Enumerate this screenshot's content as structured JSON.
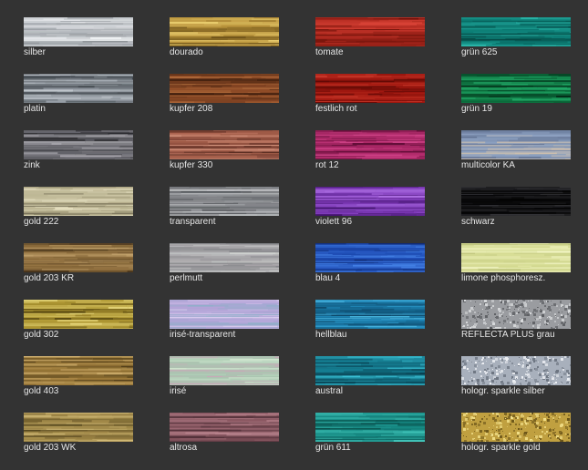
{
  "swatches": [
    {
      "label": "silber",
      "colors": [
        "#c4c8cc",
        "#f2f4f6",
        "#8c9196"
      ],
      "pattern": "stripe"
    },
    {
      "label": "platin",
      "colors": [
        "#868d94",
        "#c6ccd2",
        "#3c4248"
      ],
      "pattern": "stripe"
    },
    {
      "label": "zink",
      "colors": [
        "#5a5a60",
        "#a8a6ac",
        "#1e1e22"
      ],
      "pattern": "stripe"
    },
    {
      "label": "gold 222",
      "colors": [
        "#b6af8c",
        "#e6e0c2",
        "#6c6650"
      ],
      "pattern": "stripe"
    },
    {
      "label": "gold 203 KR",
      "colors": [
        "#8c6c3c",
        "#d2b27a",
        "#4a361c"
      ],
      "pattern": "stripe"
    },
    {
      "label": "gold 302",
      "colors": [
        "#b09834",
        "#eadc80",
        "#5c4c12"
      ],
      "pattern": "stripe"
    },
    {
      "label": "gold 403",
      "colors": [
        "#9a7838",
        "#d6b676",
        "#4c3a18"
      ],
      "pattern": "stripe"
    },
    {
      "label": "gold 203 WK",
      "colors": [
        "#a08848",
        "#e2cc88",
        "#54461e"
      ],
      "pattern": "stripe"
    },
    {
      "label": "dourado",
      "colors": [
        "#b8923a",
        "#ecd072",
        "#6a5018"
      ],
      "pattern": "stripe"
    },
    {
      "label": "kupfer 208",
      "colors": [
        "#8c4a26",
        "#d2884e",
        "#3a1c0c"
      ],
      "pattern": "stripe"
    },
    {
      "label": "kupfer 330",
      "colors": [
        "#a8604c",
        "#d89a84",
        "#5a2c22"
      ],
      "pattern": "stripe"
    },
    {
      "label": "transparent",
      "colors": [
        "#8e9094",
        "#c8cacc",
        "#4e5054"
      ],
      "pattern": "stripe"
    },
    {
      "label": "perlmutt",
      "colors": [
        "#a4a2a6",
        "#cfd2d0",
        "#7a7c80"
      ],
      "pattern": "stripe"
    },
    {
      "label": "irisé-transparent",
      "colors": [
        "#b4a4d8",
        "#e4d8f4",
        "#8cb0c8"
      ],
      "pattern": "stripe"
    },
    {
      "label": "irisé",
      "colors": [
        "#a8c8b0",
        "#e0f0dc",
        "#c8a8b8"
      ],
      "pattern": "stripe"
    },
    {
      "label": "altrosa",
      "colors": [
        "#8c5a64",
        "#c48e98",
        "#4c2c34"
      ],
      "pattern": "stripe"
    },
    {
      "label": "tomate",
      "colors": [
        "#b02a20",
        "#e0483a",
        "#6a1008"
      ],
      "pattern": "stripe"
    },
    {
      "label": "festlich rot",
      "colors": [
        "#a01810",
        "#cc3a2c",
        "#5a0804"
      ],
      "pattern": "stripe"
    },
    {
      "label": "rot 12",
      "colors": [
        "#b02a6a",
        "#e05098",
        "#5c0c34"
      ],
      "pattern": "stripe"
    },
    {
      "label": "violett 96",
      "colors": [
        "#7e3ab8",
        "#b478ea",
        "#3c1064"
      ],
      "pattern": "stripe"
    },
    {
      "label": "blau 4",
      "colors": [
        "#1e4cb4",
        "#4c8cf0",
        "#0a1e5c"
      ],
      "pattern": "stripe"
    },
    {
      "label": "hellblau",
      "colors": [
        "#1e84b4",
        "#52c0ea",
        "#0a3c5a"
      ],
      "pattern": "stripe"
    },
    {
      "label": "austral",
      "colors": [
        "#167c90",
        "#3cc4d8",
        "#063848"
      ],
      "pattern": "stripe"
    },
    {
      "label": "grün 611",
      "colors": [
        "#168a84",
        "#44c8bc",
        "#063e3a"
      ],
      "pattern": "stripe"
    },
    {
      "label": "grün 625",
      "colors": [
        "#0c7c74",
        "#2cbcae",
        "#043a36"
      ],
      "pattern": "stripe"
    },
    {
      "label": "grün 19",
      "colors": [
        "#0c6c3c",
        "#24b06c",
        "#032e18"
      ],
      "pattern": "stripe"
    },
    {
      "label": "multicolor KA",
      "colors": [
        "#8ca0c0",
        "#e0c8a8",
        "#5c6c8c"
      ],
      "pattern": "stripe"
    },
    {
      "label": "schwarz",
      "colors": [
        "#101012",
        "#3a3a3e",
        "#000000"
      ],
      "pattern": "stripe"
    },
    {
      "label": "limone phosphoresz.",
      "colors": [
        "#d6dc94",
        "#f2f4c4",
        "#b6bc74"
      ],
      "pattern": "stripe"
    },
    {
      "label": "REFLECTA PLUS grau",
      "colors": [
        "#9a9ca0",
        "#d8dadc",
        "#5c5e62"
      ],
      "pattern": "speckle"
    },
    {
      "label": "hologr. sparkle silber",
      "colors": [
        "#a8b0bc",
        "#eef0f4",
        "#6c7480"
      ],
      "pattern": "speckle"
    },
    {
      "label": "hologr. sparkle gold",
      "colors": [
        "#c0a040",
        "#f2e08a",
        "#6a5418"
      ],
      "pattern": "speckle"
    }
  ]
}
